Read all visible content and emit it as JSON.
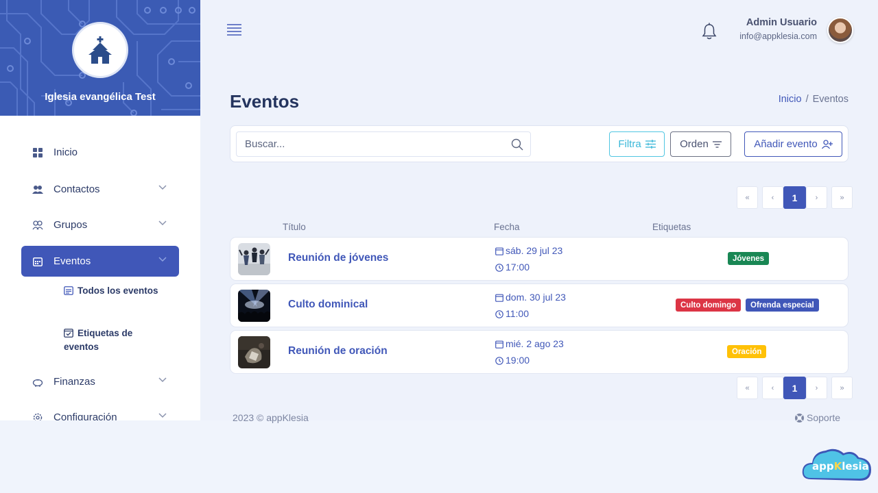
{
  "sidebar": {
    "church_name": "Iglesia evangélica Test",
    "items": [
      {
        "label": "Inicio",
        "icon": "grid-icon"
      },
      {
        "label": "Contactos",
        "icon": "users-icon"
      },
      {
        "label": "Grupos",
        "icon": "group-icon"
      },
      {
        "label": "Eventos",
        "icon": "calendar-icon"
      },
      {
        "label": "Finanzas",
        "icon": "piggy-bank-icon"
      },
      {
        "label": "Configuración",
        "icon": "gear-icon"
      }
    ],
    "sub_items": [
      {
        "label": "Todos los eventos",
        "icon": "calendar-list-icon"
      },
      {
        "label": "Etiquetas de eventos",
        "icon": "calendar-check-icon"
      }
    ]
  },
  "header": {
    "user_name": "Admin Usuario",
    "user_email": "info@appklesia.com"
  },
  "page": {
    "title": "Eventos",
    "breadcrumb": {
      "home": "Inicio",
      "sep": "/",
      "current": "Eventos"
    }
  },
  "toolbar": {
    "search_placeholder": "Buscar...",
    "filter_label": "Filtra",
    "order_label": "Orden",
    "add_label": "Añadir evento"
  },
  "pagination": {
    "first": "«",
    "prev": "‹",
    "current": "1",
    "next": "›",
    "last": "»"
  },
  "table": {
    "headers": {
      "title": "Título",
      "date": "Fecha",
      "tags": "Etiquetas"
    },
    "rows": [
      {
        "title": "Reunión de jóvenes",
        "date": "sáb. 29 jul 23",
        "time": "17:00",
        "tags": [
          {
            "label": "Jóvenes",
            "color": "#198754"
          }
        ]
      },
      {
        "title": "Culto dominical",
        "date": "dom. 30 jul 23",
        "time": "11:00",
        "tags": [
          {
            "label": "Culto domingo",
            "color": "#dc3545"
          },
          {
            "label": "Ofrenda especial",
            "color": "#4057b8"
          }
        ]
      },
      {
        "title": "Reunión de oración",
        "date": "mié. 2 ago 23",
        "time": "19:00",
        "tags": [
          {
            "label": "Oración",
            "color": "#ffc107"
          }
        ]
      }
    ]
  },
  "footer": {
    "copyright": "2023 © appKlesia",
    "support": "Soporte"
  },
  "brand": {
    "text_pre": "app",
    "text_k": "K",
    "text_post": "lesia"
  },
  "colors": {
    "primary": "#4057b8",
    "accent": "#39b7d8",
    "background": "#eef2fb"
  }
}
